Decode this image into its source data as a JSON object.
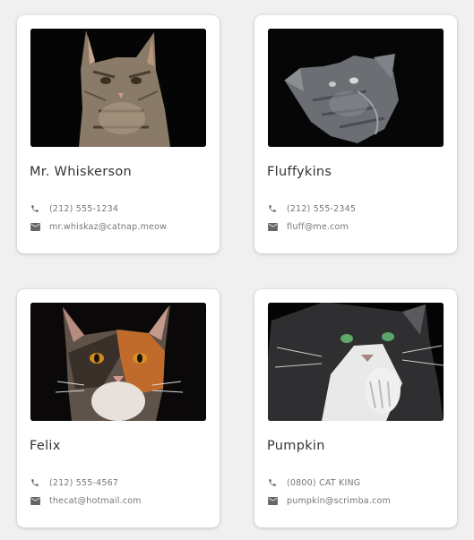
{
  "cards": [
    {
      "name": "Mr. Whiskerson",
      "phone": "(212) 555-1234",
      "email": "mr.whiskaz@catnap.meow",
      "photo": "tabby-cat"
    },
    {
      "name": "Fluffykins",
      "phone": "(212) 555-2345",
      "email": "fluff@me.com",
      "photo": "gray-cat"
    },
    {
      "name": "Felix",
      "phone": "(212) 555-4567",
      "email": "thecat@hotmail.com",
      "photo": "calico-cat"
    },
    {
      "name": "Pumpkin",
      "phone": "(0800) CAT KING",
      "email": "pumpkin@scrimba.com",
      "photo": "tuxedo-cat"
    }
  ],
  "icons": {
    "phone": "phone-icon",
    "email": "email-icon"
  },
  "colors": {
    "background": "#f0f0f0",
    "card": "#ffffff",
    "name_text": "#333333",
    "info_text": "#777777"
  }
}
